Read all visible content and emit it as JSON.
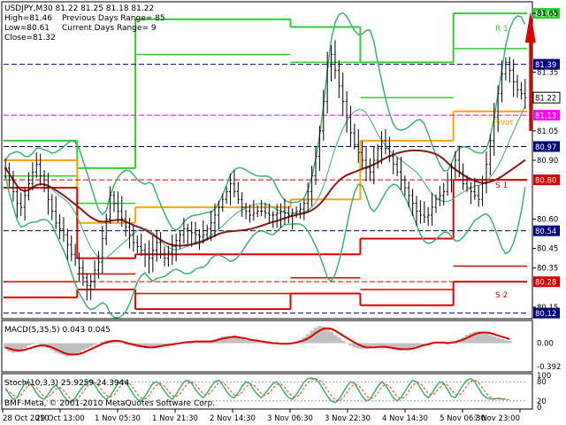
{
  "window": {
    "header": "USDJPY,M30  81.22 81.25 81.18 81.22",
    "info": [
      {
        "label": "High=81.46",
        "extra": "Previous Days Range= 85"
      },
      {
        "label": "Low=80.61",
        "extra": "Current Days Range= 9"
      },
      {
        "label": "Close=81.32",
        "extra": ""
      }
    ],
    "copyright": "BMF-Meta, © 2001-2010 MetaQuotes Software Corp."
  },
  "colors": {
    "background": "#ffffff",
    "candle": "#000000",
    "bollinger": "#3cb371",
    "ma": "#8b1a1a",
    "resistance": "#32cd32",
    "pivot": "#ffa500",
    "support": "#dd0000",
    "macd_hist": "#c0c0c0",
    "macd_signal": "#dd0000",
    "stoch_main": "#3cb371",
    "stoch_signal": "#ff4500"
  },
  "chart_data": {
    "type": "candlestick",
    "symbol": "USDJPY",
    "timeframe": "M30",
    "ylim": [
      80.1,
      81.7
    ],
    "price_ticks": [
      "81.65",
      "81.35",
      "81.05",
      "80.90",
      "80.60",
      "80.45",
      "80.35",
      "80.15"
    ],
    "x_labels": [
      "28 Oct 2010",
      "29 Oct 13:00",
      "1 Nov 05:30",
      "1 Nov 21:30",
      "2 Nov 14:30",
      "3 Nov 06:30",
      "3 Nov 22:30",
      "4 Nov 14:30",
      "5 Nov 06:30",
      "7 Nov 23:00"
    ],
    "price_tags": [
      {
        "label": "81.65",
        "value": 81.65,
        "color": "#32cd32"
      },
      {
        "label": "81.39",
        "value": 81.39,
        "color": "#000080"
      },
      {
        "label": "81.22",
        "value": 81.22,
        "color": "#000000"
      },
      {
        "label": "81.13",
        "value": 81.13,
        "color": "#ff00ff"
      },
      {
        "label": "80.97",
        "value": 80.97,
        "color": "#000080"
      },
      {
        "label": "80.80",
        "value": 80.8,
        "color": "#dd0000"
      },
      {
        "label": "80.54",
        "value": 80.54,
        "color": "#000080"
      },
      {
        "label": "80.28",
        "value": 80.28,
        "color": "#dd0000"
      },
      {
        "label": "80.12",
        "value": 80.12,
        "color": "#000080"
      }
    ],
    "level_labels": {
      "r1": "R 1",
      "pivot": "Pivot",
      "s1": "S 1",
      "s2": "S 2"
    },
    "close_series": [
      80.86,
      80.8,
      80.74,
      80.68,
      80.66,
      80.72,
      80.78,
      80.84,
      80.88,
      80.82,
      80.76,
      80.7,
      80.64,
      80.58,
      80.55,
      80.52,
      80.47,
      80.42,
      80.4,
      80.35,
      80.3,
      80.26,
      80.28,
      80.34,
      80.38,
      80.5,
      80.6,
      80.72,
      80.68,
      80.64,
      80.6,
      80.56,
      80.52,
      80.48,
      80.46,
      80.44,
      80.42,
      80.4,
      80.44,
      80.48,
      80.42,
      80.4,
      80.43,
      80.46,
      80.49,
      80.52,
      80.55,
      80.54,
      80.53,
      80.52,
      80.51,
      80.52,
      80.55,
      80.58,
      80.62,
      80.66,
      80.7,
      80.74,
      80.78,
      80.74,
      80.7,
      80.66,
      80.64,
      80.62,
      80.63,
      80.64,
      80.64,
      80.63,
      80.62,
      80.62,
      80.63,
      80.64,
      80.63,
      80.62,
      80.63,
      80.64,
      80.65,
      80.68,
      80.74,
      80.82,
      80.92,
      81.05,
      81.2,
      81.38,
      81.44,
      81.36,
      81.28,
      81.2,
      81.12,
      81.04,
      80.98,
      80.94,
      80.9,
      80.86,
      80.84,
      80.9,
      80.96,
      81.0,
      80.96,
      80.92,
      80.88,
      80.84,
      80.8,
      80.76,
      80.72,
      80.68,
      80.64,
      80.62,
      80.61,
      80.62,
      80.66,
      80.7,
      80.72,
      80.74,
      80.8,
      80.86,
      80.9,
      80.84,
      80.78,
      80.76,
      80.74,
      80.72,
      80.7,
      80.78,
      80.88,
      81.0,
      81.12,
      81.24,
      81.34,
      81.4,
      81.36,
      81.3,
      81.26,
      81.24,
      81.22
    ],
    "sr_levels": {
      "r1": [
        [
          0,
          81.0
        ],
        [
          19,
          80.86
        ],
        [
          34,
          81.62
        ],
        [
          74,
          81.58
        ],
        [
          92,
          81.4
        ],
        [
          116,
          81.65
        ]
      ],
      "pivot": [
        [
          0,
          80.9
        ],
        [
          19,
          80.58
        ],
        [
          34,
          80.66
        ],
        [
          74,
          80.7
        ],
        [
          92,
          81.0
        ],
        [
          116,
          81.15
        ]
      ],
      "s1": [
        [
          0,
          80.76
        ],
        [
          19,
          80.4
        ],
        [
          34,
          80.42
        ],
        [
          74,
          80.42
        ],
        [
          92,
          80.5
        ],
        [
          116,
          80.8
        ]
      ],
      "s2": [
        [
          0,
          80.2
        ],
        [
          19,
          80.24
        ],
        [
          34,
          80.14
        ],
        [
          74,
          80.22
        ],
        [
          92,
          80.16
        ],
        [
          116,
          80.28
        ]
      ]
    },
    "macd": {
      "label": "MACD(5,35,5) 0.043 0.045",
      "ticks": [
        "0.00",
        "-0.392"
      ],
      "ylim": [
        -0.45,
        0.35
      ],
      "hist": [
        -0.1,
        -0.14,
        -0.16,
        -0.15,
        -0.12,
        -0.08,
        -0.04,
        -0.02,
        -0.01,
        -0.02,
        -0.05,
        -0.08,
        -0.12,
        -0.16,
        -0.18,
        -0.2,
        -0.22,
        -0.21,
        -0.19,
        -0.16,
        -0.12,
        -0.09,
        -0.06,
        -0.03,
        0.0,
        0.03,
        0.05,
        0.05,
        0.04,
        0.02,
        0.0,
        -0.02,
        -0.03,
        -0.05,
        -0.06,
        -0.07,
        -0.08,
        -0.07,
        -0.06,
        -0.05,
        -0.04,
        -0.03,
        -0.02,
        -0.01,
        0.0,
        0.01,
        0.02,
        0.03,
        0.03,
        0.03,
        0.02,
        0.02,
        0.03,
        0.05,
        0.07,
        0.09,
        0.11,
        0.12,
        0.12,
        0.11,
        0.09,
        0.07,
        0.05,
        0.04,
        0.03,
        0.02,
        0.01,
        0.0,
        0.0,
        -0.01,
        -0.01,
        -0.01,
        -0.01,
        0.0,
        0.01,
        0.03,
        0.06,
        0.1,
        0.15,
        0.21,
        0.26,
        0.29,
        0.28,
        0.24,
        0.19,
        0.14,
        0.09,
        0.04,
        0.0,
        -0.04,
        -0.07,
        -0.09,
        -0.1,
        -0.09,
        -0.07,
        -0.05,
        -0.04,
        -0.05,
        -0.07,
        -0.09,
        -0.11,
        -0.12,
        -0.12,
        -0.11,
        -0.09,
        -0.07,
        -0.05,
        -0.03,
        -0.01,
        0.01,
        0.02,
        0.02,
        0.01,
        0.0,
        0.0,
        0.01,
        0.03,
        0.06,
        0.1,
        0.14,
        0.17,
        0.19,
        0.2,
        0.19,
        0.17,
        0.14,
        0.11,
        0.09,
        0.07,
        0.05,
        0.04
      ],
      "signal": [
        -0.07,
        -0.09,
        -0.11,
        -0.12,
        -0.12,
        -0.11,
        -0.09,
        -0.07,
        -0.05,
        -0.04,
        -0.04,
        -0.05,
        -0.07,
        -0.1,
        -0.13,
        -0.16,
        -0.18,
        -0.19,
        -0.19,
        -0.18,
        -0.16,
        -0.13,
        -0.1,
        -0.07,
        -0.04,
        -0.01,
        0.01,
        0.03,
        0.04,
        0.04,
        0.03,
        0.01,
        -0.01,
        -0.02,
        -0.04,
        -0.05,
        -0.06,
        -0.07,
        -0.07,
        -0.06,
        -0.05,
        -0.04,
        -0.03,
        -0.02,
        -0.01,
        0.0,
        0.01,
        0.02,
        0.02,
        0.03,
        0.03,
        0.03,
        0.03,
        0.03,
        0.04,
        0.06,
        0.08,
        0.09,
        0.1,
        0.11,
        0.1,
        0.09,
        0.08,
        0.06,
        0.05,
        0.04,
        0.03,
        0.02,
        0.01,
        0.0,
        0.0,
        -0.01,
        -0.01,
        -0.01,
        0.0,
        0.01,
        0.03,
        0.05,
        0.08,
        0.12,
        0.17,
        0.21,
        0.24,
        0.25,
        0.24,
        0.21,
        0.17,
        0.13,
        0.09,
        0.05,
        0.01,
        -0.02,
        -0.05,
        -0.07,
        -0.07,
        -0.07,
        -0.06,
        -0.06,
        -0.06,
        -0.07,
        -0.08,
        -0.09,
        -0.1,
        -0.1,
        -0.1,
        -0.09,
        -0.07,
        -0.05,
        -0.03,
        -0.02,
        0.0,
        0.01,
        0.01,
        0.01,
        0.0,
        0.01,
        0.02,
        0.04,
        0.06,
        0.09,
        0.12,
        0.15,
        0.17,
        0.18,
        0.18,
        0.17,
        0.15,
        0.13,
        0.11,
        0.09,
        0.07
      ]
    },
    "stochastic": {
      "label": "Stoch(10,3,3) 25.9259 24.3944",
      "ticks": [
        "100",
        "80",
        "20",
        "0"
      ],
      "ylim": [
        0,
        100
      ],
      "main": [
        60,
        40,
        25,
        30,
        55,
        75,
        80,
        65,
        45,
        30,
        25,
        40,
        60,
        70,
        55,
        35,
        20,
        15,
        30,
        50,
        65,
        80,
        85,
        70,
        50,
        35,
        25,
        35,
        55,
        75,
        85,
        80,
        60,
        40,
        25,
        20,
        35,
        55,
        75,
        80,
        70,
        50,
        35,
        25,
        40,
        60,
        80,
        85,
        75,
        55,
        40,
        30,
        45,
        65,
        80,
        85,
        70,
        50,
        35,
        30,
        45,
        65,
        80,
        75,
        55,
        40,
        30,
        45,
        60,
        75,
        80,
        65,
        45,
        30,
        25,
        40,
        60,
        80,
        90,
        92,
        88,
        75,
        55,
        35,
        20,
        15,
        25,
        45,
        65,
        80,
        75,
        55,
        35,
        20,
        25,
        45,
        65,
        80,
        70,
        50,
        30,
        20,
        30,
        50,
        70,
        85,
        80,
        60,
        40,
        30,
        45,
        65,
        80,
        75,
        55,
        35,
        30,
        50,
        70,
        85,
        90,
        80,
        60,
        40,
        30,
        26,
        26,
        28,
        26,
        26
      ],
      "signal": [
        55,
        48,
        38,
        32,
        38,
        55,
        70,
        73,
        63,
        47,
        33,
        32,
        42,
        57,
        62,
        53,
        37,
        23,
        22,
        32,
        48,
        65,
        77,
        78,
        68,
        52,
        37,
        32,
        38,
        55,
        72,
        80,
        75,
        60,
        42,
        28,
        27,
        37,
        55,
        70,
        75,
        67,
        52,
        37,
        33,
        42,
        60,
        75,
        80,
        72,
        57,
        42,
        38,
        47,
        63,
        77,
        78,
        68,
        52,
        38,
        37,
        47,
        63,
        73,
        70,
        57,
        42,
        38,
        45,
        60,
        72,
        73,
        63,
        47,
        33,
        32,
        42,
        60,
        77,
        87,
        90,
        85,
        73,
        55,
        37,
        23,
        20,
        28,
        45,
        63,
        73,
        70,
        55,
        37,
        27,
        30,
        45,
        63,
        72,
        67,
        50,
        33,
        27,
        33,
        50,
        68,
        78,
        75,
        60,
        43,
        38,
        47,
        63,
        73,
        70,
        55,
        40,
        38,
        50,
        68,
        82,
        85,
        77,
        60,
        43,
        32,
        27,
        27,
        27,
        24,
        24
      ]
    }
  }
}
